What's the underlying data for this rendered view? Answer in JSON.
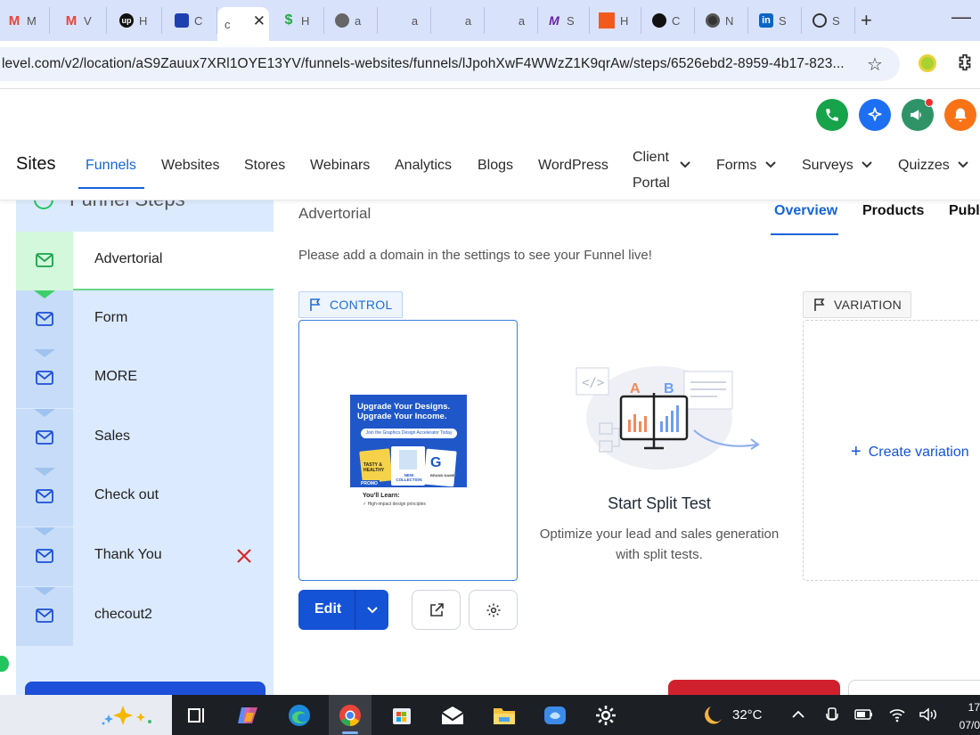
{
  "browser": {
    "tabs": [
      {
        "icon": "gmail-icon",
        "label": "M"
      },
      {
        "icon": "gmail-icon",
        "label": "V"
      },
      {
        "icon": "upwork-icon",
        "label": "H"
      },
      {
        "icon": "shopping-bag-icon",
        "label": "C"
      },
      {
        "icon": "chrome-page-icon",
        "label": "c"
      },
      {
        "icon": "dollar-icon",
        "label": "H"
      },
      {
        "icon": "globe-icon",
        "label": "a"
      },
      {
        "icon": "blank-icon",
        "label": "a"
      },
      {
        "icon": "blank-icon",
        "label": "a"
      },
      {
        "icon": "blank-icon",
        "label": "a"
      },
      {
        "icon": "m-logo-icon",
        "label": "S"
      },
      {
        "icon": "orange-square-icon",
        "label": "H"
      },
      {
        "icon": "github-icon",
        "label": "C"
      },
      {
        "icon": "chrome-icon",
        "label": "N"
      },
      {
        "icon": "linkedin-icon",
        "label": "S"
      },
      {
        "icon": "openai-icon",
        "label": "S"
      }
    ],
    "active_tab_close": "✕",
    "new_tab": "+",
    "minimize": "—",
    "url": "level.com/v2/location/aS9Zauux7XRl1OYE13YV/funnels-websites/funnels/lJpohXwF4WWzZ1K9qrAw/steps/6526ebd2-8959-4b17-823..."
  },
  "header": {
    "section_title": "Sites",
    "nav": [
      {
        "label": "Funnels"
      },
      {
        "label": "Websites"
      },
      {
        "label": "Stores"
      },
      {
        "label": "Webinars"
      },
      {
        "label": "Analytics"
      },
      {
        "label": "Blogs"
      },
      {
        "label": "WordPress"
      },
      {
        "label": "Client Portal"
      },
      {
        "label": "Forms"
      },
      {
        "label": "Surveys"
      },
      {
        "label": "Quizzes"
      }
    ],
    "actions": [
      "phone-icon",
      "sparkle-icon",
      "megaphone-icon",
      "bell-icon"
    ],
    "colors": {
      "phone": "#16a34a",
      "sparkle": "#1d6ff2",
      "megaphone": "#2e9467",
      "bell": "#f97316",
      "accent": "#1565d8"
    }
  },
  "sidebar": {
    "title": "Funnel Steps",
    "steps": [
      {
        "label": "Advertorial",
        "active": true
      },
      {
        "label": "Form"
      },
      {
        "label": "MORE"
      },
      {
        "label": "Sales"
      },
      {
        "label": "Check out"
      },
      {
        "label": "Thank You",
        "has_delete": true
      },
      {
        "label": "checout2"
      }
    ]
  },
  "main": {
    "step_name": "Advertorial",
    "tabs": [
      {
        "label": "Overview",
        "active": true
      },
      {
        "label": "Products"
      },
      {
        "label": "Publi"
      }
    ],
    "notice": "Please add a domain in the settings to see your Funnel live!",
    "control_badge": "CONTROL",
    "variation_badge": "VARIATION",
    "thumbnail": {
      "headline": "Upgrade Your Designs. Upgrade Your Income.",
      "pill": "Join the Graphics Design Accelerator Today",
      "card1": "TASTY & HEALTHY",
      "card2": "NEW COLLECTION",
      "card3_letter": "G",
      "card3_label": "BRAND NAME",
      "promo": "PROMO",
      "learn_title": "You'll Learn:",
      "learn_item": "✓ High-impact design principles"
    },
    "edit_label": "Edit",
    "split_test": {
      "title": "Start Split Test",
      "description": "Optimize your lead and sales generation with split tests.",
      "label_a": "A",
      "label_b": "B"
    },
    "create_variation": "Create variation"
  },
  "taskbar": {
    "temperature": "32°C",
    "time": "17",
    "date": "07/0"
  }
}
